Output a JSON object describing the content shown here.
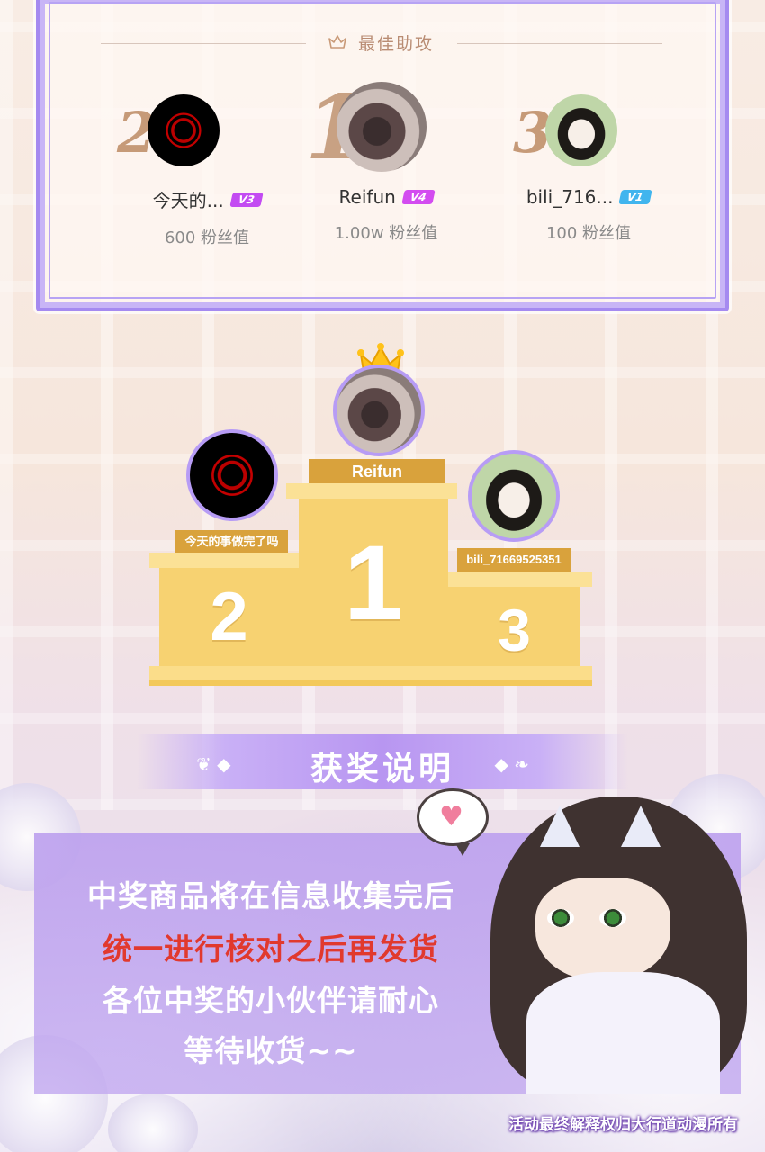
{
  "top_board": {
    "title": "最佳助攻",
    "ranks": [
      {
        "rank": "2",
        "name": "今天的...",
        "level": "V3",
        "level_color": "#c34bf2",
        "fans": "600 粉丝值"
      },
      {
        "rank": "1",
        "name": "Reifun",
        "level": "V4",
        "level_color": "#d34cf0",
        "fans": "1.00w 粉丝值"
      },
      {
        "rank": "3",
        "name": "bili_716...",
        "level": "V1",
        "level_color": "#41b5ee",
        "fans": "100 粉丝值"
      }
    ]
  },
  "podium": {
    "first": {
      "number": "1",
      "name": "Reifun"
    },
    "second": {
      "number": "2",
      "name": "今天的事做完了吗"
    },
    "third": {
      "number": "3",
      "name": "bili_71669525351"
    }
  },
  "notice": {
    "title": "获奖说明",
    "lines": [
      {
        "text": "中奖商品将在信息收集完后",
        "color": "#ffffff"
      },
      {
        "text": "统一进行核对之后再发货",
        "color": "#e1392e"
      },
      {
        "text": "各位中奖的小伙伴请耐心",
        "color": "#ffffff"
      },
      {
        "text": "等待收货~~",
        "color": "#ffffff"
      }
    ]
  },
  "footer": "活动最终解释权归大行道动漫所有",
  "colors": {
    "accent": "#a58af0",
    "podium": "#f7d271",
    "label": "#d9a23c"
  }
}
